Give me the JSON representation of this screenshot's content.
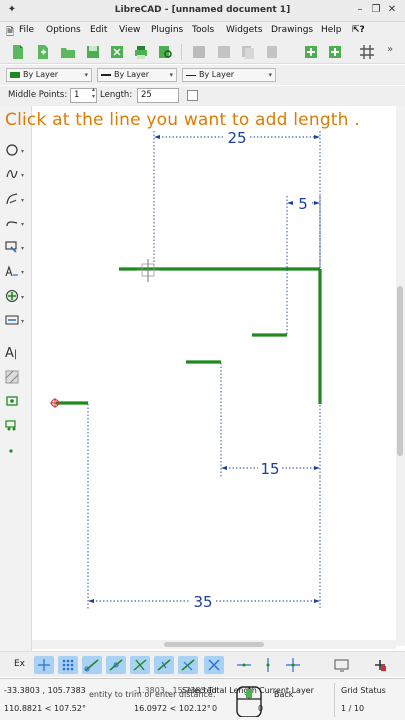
{
  "window": {
    "title": "LibreCAD - [unnamed document 1]"
  },
  "menu": [
    "File",
    "Options",
    "Edit",
    "View",
    "Plugins",
    "Tools",
    "Widgets",
    "Drawings",
    "Help"
  ],
  "properties": {
    "color": "By Layer",
    "linetype": "By Layer",
    "linewidth": "By Layer",
    "color_swatch": "#1f8a1f"
  },
  "options": {
    "middle_points_label": "Middle Points:",
    "middle_points_value": "1",
    "length_label": "Length:",
    "length_value": "25"
  },
  "prompt": "Click at the line you want to add length .",
  "dimensions": {
    "top": "25",
    "right": "5",
    "mid": "15",
    "bottom": "35"
  },
  "snap": {
    "ex_label": "Ex"
  },
  "status": {
    "coord_abs": "-33.3803 , 105.7383",
    "coord_polar": "110.8821 < 107.52°",
    "coord_rel": "-1.3803 , 15.7383",
    "coord_rel_polar": "16.0972 < 102.12°",
    "command_hint": "entity to trim or enter distance.",
    "selected_label": "Selected",
    "total_length_label": "Total Length",
    "selected_value": "0",
    "total_length_value": "0",
    "current_layer_label": "Current Layer",
    "layer_name": "Back",
    "grid_status_label": "Grid Status",
    "grid_value": "1 / 10"
  },
  "colors": {
    "entity": "#1f8a1f",
    "dimension": "#1d3f9e",
    "prompt": "#e07a00"
  }
}
